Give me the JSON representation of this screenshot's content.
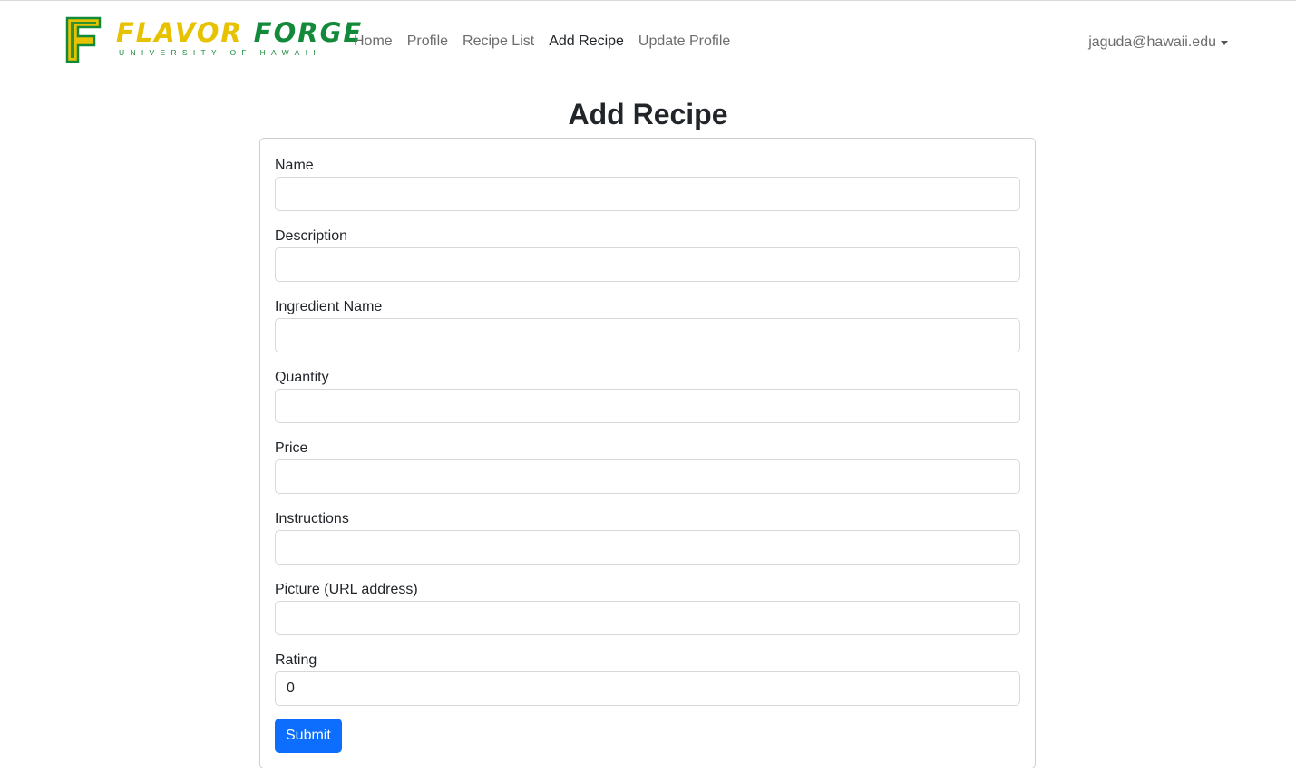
{
  "brand": {
    "word1": "FLAVOR",
    "word2": "FORGE",
    "subtitle": "UNIVERSITY OF HAWAII",
    "colors": {
      "yellow": "#e6c200",
      "green": "#128a3a"
    }
  },
  "nav": {
    "links": [
      {
        "label": "Home"
      },
      {
        "label": "Profile"
      },
      {
        "label": "Recipe List"
      },
      {
        "label": "Add Recipe",
        "active": true
      },
      {
        "label": "Update Profile"
      }
    ],
    "user_email": "jaguda@hawaii.edu"
  },
  "page": {
    "title": "Add Recipe"
  },
  "form": {
    "fields": [
      {
        "label": "Name",
        "value": ""
      },
      {
        "label": "Description",
        "value": ""
      },
      {
        "label": "Ingredient Name",
        "value": ""
      },
      {
        "label": "Quantity",
        "value": ""
      },
      {
        "label": "Price",
        "value": ""
      },
      {
        "label": "Instructions",
        "value": ""
      },
      {
        "label": "Picture (URL address)",
        "value": ""
      },
      {
        "label": "Rating",
        "value": "0"
      }
    ],
    "submit_label": "Submit",
    "colors": {
      "primary": "#0d6efd"
    }
  }
}
